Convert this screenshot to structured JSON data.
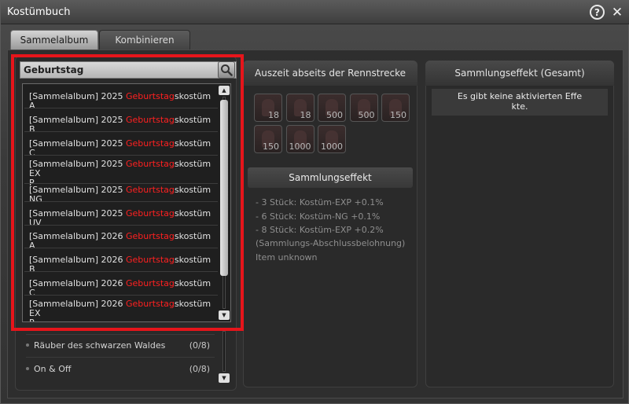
{
  "window": {
    "title": "Kostümbuch"
  },
  "titlebar": {
    "help_glyph": "?",
    "close_glyph": "✕"
  },
  "tabs": [
    {
      "label": "Sammelalbum",
      "active": true
    },
    {
      "label": "Kombinieren",
      "active": false
    }
  ],
  "search": {
    "value": "Geburtstag",
    "icon": "magnifier-icon"
  },
  "dropdown": {
    "items": [
      {
        "prefix": "[Sammelalbum] 2025 ",
        "match": "Geburtstag",
        "suffix": "skostüm A"
      },
      {
        "prefix": "[Sammelalbum] 2025 ",
        "match": "Geburtstag",
        "suffix": "skostüm B"
      },
      {
        "prefix": "[Sammelalbum] 2025 ",
        "match": "Geburtstag",
        "suffix": "skostüm C"
      },
      {
        "prefix": "[Sammelalbum] 2025 ",
        "match": "Geburtstag",
        "suffix": "skostüm EX",
        "wrap": "P"
      },
      {
        "prefix": "[Sammelalbum] 2025 ",
        "match": "Geburtstag",
        "suffix": "skostüm NG"
      },
      {
        "prefix": "[Sammelalbum] 2025 ",
        "match": "Geburtstag",
        "suffix": "skostüm UV"
      },
      {
        "prefix": "[Sammelalbum] 2026 ",
        "match": "Geburtstag",
        "suffix": "skostüm A"
      },
      {
        "prefix": "[Sammelalbum] 2026 ",
        "match": "Geburtstag",
        "suffix": "skostüm B"
      },
      {
        "prefix": "[Sammelalbum] 2026 ",
        "match": "Geburtstag",
        "suffix": "skostüm C"
      },
      {
        "prefix": "[Sammelalbum] 2026 ",
        "match": "Geburtstag",
        "suffix": "skostüm EX",
        "wrap": "P"
      }
    ],
    "match_color": "#ff2020"
  },
  "album_list": [
    {
      "name": "Räuber des schwarzen Waldes",
      "count": "(0/8)"
    },
    {
      "name": "On & Off",
      "count": "(0/8)"
    }
  ],
  "middle": {
    "title": "Auszeit abseits der Rennstrecke",
    "slots": [
      {
        "qty": "18"
      },
      {
        "qty": "18"
      },
      {
        "qty": "500"
      },
      {
        "qty": "500"
      },
      {
        "qty": "150"
      },
      {
        "qty": "150"
      },
      {
        "qty": "1000"
      },
      {
        "qty": "1000"
      }
    ],
    "effect_title": "Sammlungseffekt",
    "effects": [
      "- 3 Stück: Kostüm-EXP +0.1%",
      "- 6 Stück: Kostüm-NG +0.1%",
      "- 8 Stück: Kostüm-EXP +0.2%",
      "(Sammlungs-Abschlussbelohnung)",
      "Item unknown"
    ]
  },
  "right": {
    "title": "Sammlungseffekt (Gesamt)",
    "message_line1": "Es gibt keine aktivierten Effe",
    "message_line2": "kte."
  },
  "colors": {
    "highlight_border": "#e6151b"
  }
}
